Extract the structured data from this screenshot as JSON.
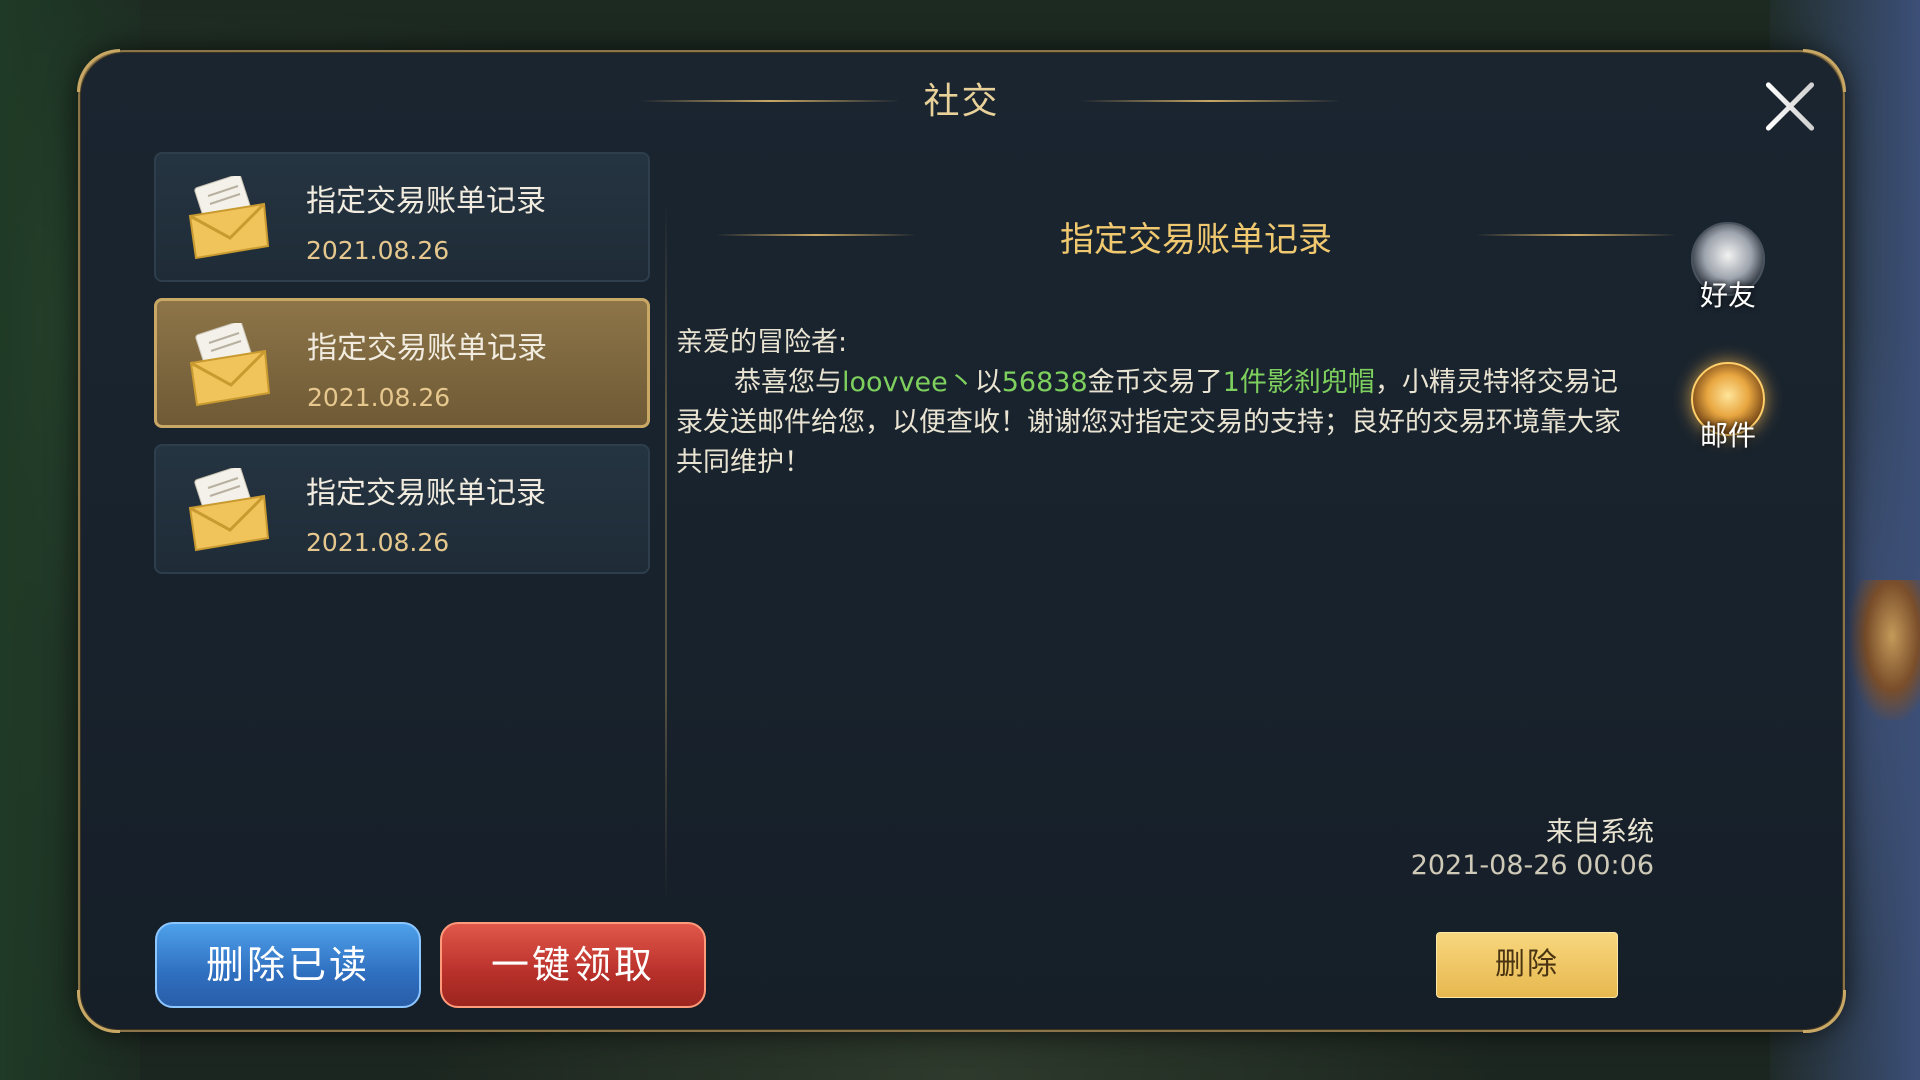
{
  "window": {
    "title": "社交"
  },
  "mail_list": [
    {
      "title": "指定交易账单记录",
      "date": "2021.08.26",
      "selected": false
    },
    {
      "title": "指定交易账单记录",
      "date": "2021.08.26",
      "selected": true
    },
    {
      "title": "指定交易账单记录",
      "date": "2021.08.26",
      "selected": false
    }
  ],
  "content": {
    "title": "指定交易账单记录",
    "greeting": "亲爱的冒险者:",
    "body": {
      "p1": "恭喜您与",
      "player": "loovvee丶",
      "p2": "以",
      "gold": "56838",
      "p3": "金币交易了",
      "count": "1件",
      "item": "影刹兜帽",
      "p4": "，小精灵特将交易记录发送邮件给您，以便查收！谢谢您对指定交易的支持；良好的交易环境靠大家共同维护！"
    },
    "sender": "来自系统",
    "timestamp": "2021-08-26  00:06"
  },
  "side_tabs": {
    "friends": {
      "label": "好友",
      "icon": "friend-avatar-icon"
    },
    "mail": {
      "label": "邮件",
      "icon": "mail-feather-icon"
    }
  },
  "buttons": {
    "delete_read": "删除已读",
    "claim_all": "一键领取",
    "delete": "删除"
  },
  "colors": {
    "accent_gold": "#c9a865",
    "highlight_green": "#7ed05e",
    "title_gold": "#efc86f"
  }
}
